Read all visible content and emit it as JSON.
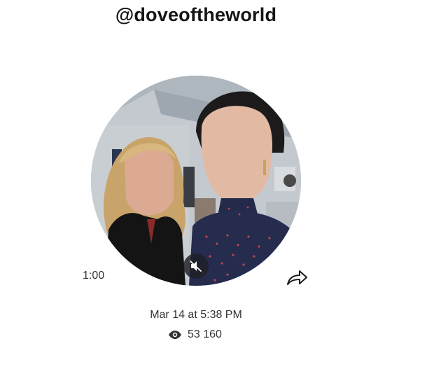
{
  "header": {
    "channel_name": "@doveoftheworld"
  },
  "video": {
    "duration": "1:00",
    "muted": true,
    "mute_icon": "speaker-muted-icon",
    "share_icon": "share-arrow-icon"
  },
  "meta": {
    "date": "Mar 14 at 5:38 PM",
    "views": "53 160",
    "views_icon": "eye-icon"
  },
  "colors": {
    "text": "#333333",
    "title": "#151515",
    "overlay": "#1e1e24"
  }
}
